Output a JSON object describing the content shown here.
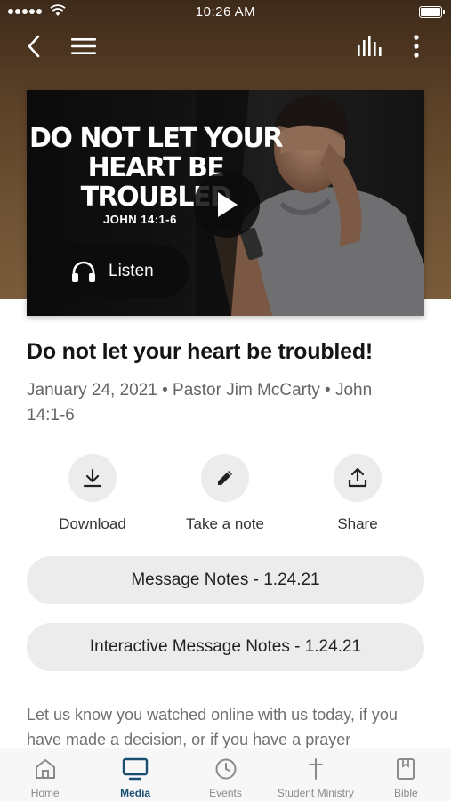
{
  "status_bar": {
    "time": "10:26 AM"
  },
  "video": {
    "thumbnail_title": "Do not let your heart be troubled",
    "thumbnail_reference": "JOHN 14:1-6",
    "listen_label": "Listen"
  },
  "sermon": {
    "title": "Do not let your heart be troubled!",
    "meta": "January 24, 2021 • Pastor Jim McCarty • John 14:1-6"
  },
  "actions": [
    {
      "label": "Download",
      "icon": "download-icon"
    },
    {
      "label": "Take a note",
      "icon": "pencil-icon"
    },
    {
      "label": "Share",
      "icon": "share-icon"
    }
  ],
  "notes": [
    {
      "label": "Message Notes - 1.24.21"
    },
    {
      "label": "Interactive Message Notes - 1.24.21"
    }
  ],
  "body_text": "Let us know you watched online with us today, if you have made a decision, or if you have a prayer",
  "tabs": [
    {
      "label": "Home",
      "icon": "home-icon",
      "active": false
    },
    {
      "label": "Media",
      "icon": "tv-icon",
      "active": true
    },
    {
      "label": "Events",
      "icon": "clock-icon",
      "active": false
    },
    {
      "label": "Student Ministry",
      "icon": "cross-icon",
      "active": false
    },
    {
      "label": "Bible",
      "icon": "bible-icon",
      "active": false
    }
  ],
  "colors": {
    "accent": "#1b4f72",
    "inactive_tab": "#8a8a8a",
    "hero_brown": "#6e5233",
    "pill_background": "#ececec"
  }
}
